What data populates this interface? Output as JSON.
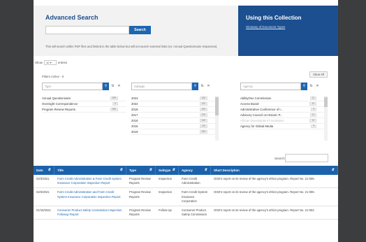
{
  "search": {
    "title": "Advanced Search",
    "input_value": "",
    "button": "Search",
    "note": "This will search within PDF files and limited in the table below but will not search external links (ex: Annual Questionnaire responses)."
  },
  "collection": {
    "title": "Using this Collection",
    "link": "Glossary of Document Types"
  },
  "entries": {
    "show": "Show",
    "value": "10",
    "suffix": "entries"
  },
  "filters": {
    "active": "Filters Active - 0",
    "clear": "Clear All",
    "type": {
      "placeholder": "Type",
      "items": [
        {
          "label": "Annual Questionnaire",
          "count": "309"
        },
        {
          "label": "Oversight Correspondence",
          "count": "6"
        },
        {
          "label": "Program Review Reports",
          "count": "390"
        }
      ]
    },
    "subtype": {
      "placeholder": "Subtype",
      "items": [
        {
          "label": "2024",
          "count": "160"
        },
        {
          "label": "2022",
          "count": "120"
        },
        {
          "label": "2018",
          "count": "160"
        },
        {
          "label": "2017",
          "count": "130"
        },
        {
          "label": "2016",
          "count": "140"
        },
        {
          "label": "2015",
          "count": "120"
        },
        {
          "label": "2019",
          "count": "160"
        }
      ]
    },
    "agency": {
      "placeholder": "Agency",
      "items": [
        {
          "label": "AbilityOne Commission",
          "count": "11"
        },
        {
          "label": "Access Board",
          "count": "10"
        },
        {
          "label": "Administrative Conference of t...",
          "count": "9"
        },
        {
          "label": "Advisory Council on Historic P...",
          "count": "11"
        },
        {
          "label": "African Development Foundation",
          "count": "13"
        },
        {
          "label": "Agency for Global Media",
          "count": "9"
        }
      ]
    }
  },
  "table_search": {
    "label": "Search:",
    "value": ""
  },
  "table": {
    "headers": [
      "Date",
      "Title",
      "Type",
      "Subtype",
      "Agency",
      "Short Description"
    ],
    "rows": [
      [
        "02/3/2021",
        "Farm Credit Administration & Farm Credit System Insurance Corporation Inspection Report",
        "Program Review Reports",
        "Inspection",
        "Farm Credit Administration",
        "OGE's report on its review of the agency's ethics program. Report No. 21-006."
      ],
      [
        "02/3/2021",
        "Farm Credit Administration and Farm Credit System Insurance Corporation Inspection Report",
        "Program Review Reports",
        "Inspection",
        "Farm Credit System Insurance Corporation",
        "OGE's report on its review of the agency's ethics program. Report No. 21-006."
      ],
      [
        "01/15/2021",
        "Consumer Product Safety Commission Inspection Followup Report",
        "Program Review Reports",
        "Follow-Up",
        "Consumer Product Safety Commission",
        "OGE's report on its review of the agency's ethics program. Report No. 21-004."
      ]
    ]
  },
  "colors": {
    "accent": "#1d66b1",
    "panel": "#1b4f8f",
    "header": "#1c62ab"
  }
}
